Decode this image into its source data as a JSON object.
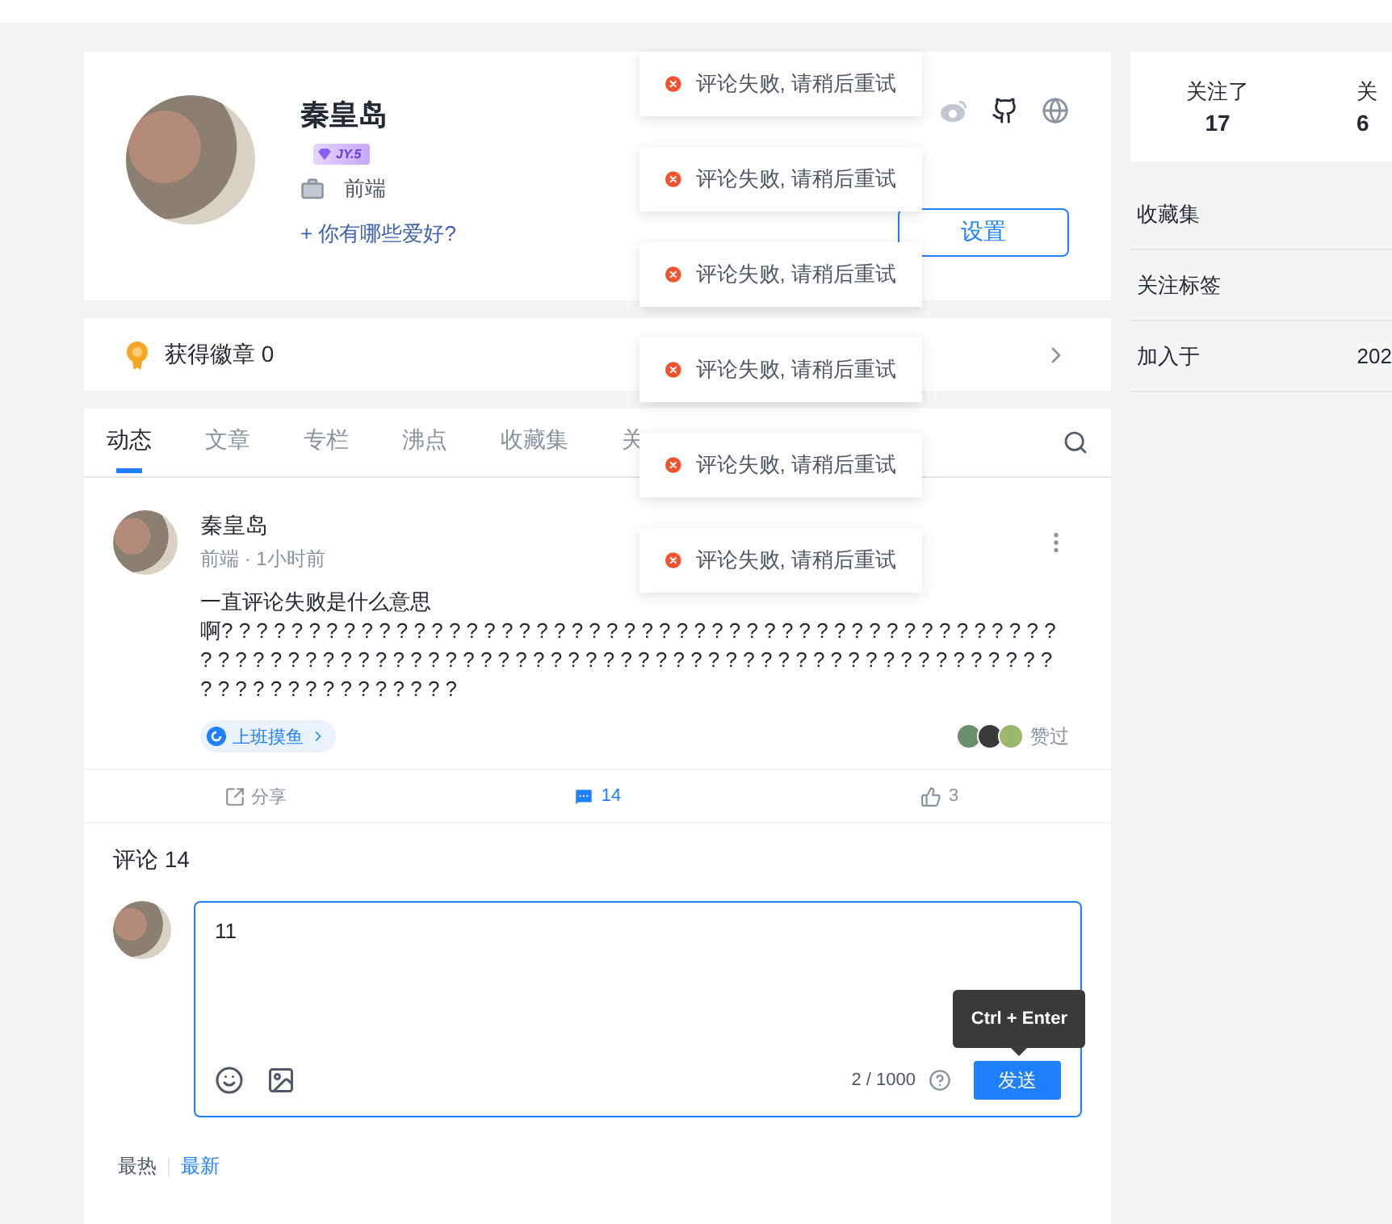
{
  "toasts": [
    {
      "text": "评论失败, 请稍后重试"
    },
    {
      "text": "评论失败, 请稍后重试"
    },
    {
      "text": "评论失败, 请稍后重试"
    },
    {
      "text": "评论失败, 请稍后重试"
    },
    {
      "text": "评论失败, 请稍后重试"
    },
    {
      "text": "评论失败, 请稍后重试"
    }
  ],
  "profile": {
    "name": "秦皇岛",
    "level_badge": "JY.5",
    "job": "前端",
    "hobby_prompt": "+ 你有哪些爱好?",
    "settings_button": "设置"
  },
  "badges": {
    "label": "获得徽章 0"
  },
  "tabs": [
    {
      "label": "动态",
      "selected": true
    },
    {
      "label": "文章",
      "selected": false
    },
    {
      "label": "专栏",
      "selected": false
    },
    {
      "label": "沸点",
      "selected": false
    },
    {
      "label": "收藏集",
      "selected": false
    },
    {
      "label": "关",
      "selected": false
    }
  ],
  "post": {
    "author": "秦皇岛",
    "meta": "前端 · 1小时前",
    "lines": [
      "一直评论失败是什么意思",
      "啊? ? ? ? ? ? ? ? ? ? ? ? ? ? ? ? ? ? ? ? ? ? ? ? ? ? ? ? ? ? ? ? ? ? ? ? ? ? ? ? ? ? ? ? ? ? ? ? ? ? ? ? ? ? ? ? ? ? ? ? ? ? ? ? ? ? ? ? ? ? ? ? ? ? ? ? ? ? ? ? ? ? ? ? ? ? ? ? ? ? ? ? ? ? ? ? ? ? ? ? ? ? ? ? ? ? ? ? ? ? ? ?"
    ],
    "tag": "上班摸鱼",
    "likers_label": "赞过",
    "actions": [
      {
        "kind": "share",
        "label": "分享",
        "active": false
      },
      {
        "kind": "comment",
        "label": "14",
        "active": true
      },
      {
        "kind": "like",
        "label": "3",
        "active": false
      }
    ]
  },
  "comments": {
    "title": "评论 14",
    "editor": {
      "value": "11",
      "counter": "2 / 1000",
      "submit": "发送",
      "tooltip": "Ctrl + Enter"
    },
    "sort": [
      {
        "label": "最热",
        "selected": false
      },
      {
        "label": "最新",
        "selected": true
      }
    ]
  },
  "sidebar": {
    "stats": [
      {
        "label": "关注了",
        "value": "17"
      },
      {
        "label": "关",
        "value": "6"
      }
    ],
    "items": [
      {
        "label": "收藏集"
      },
      {
        "label": "关注标签"
      },
      {
        "label": "加入于",
        "value": "202"
      }
    ]
  }
}
